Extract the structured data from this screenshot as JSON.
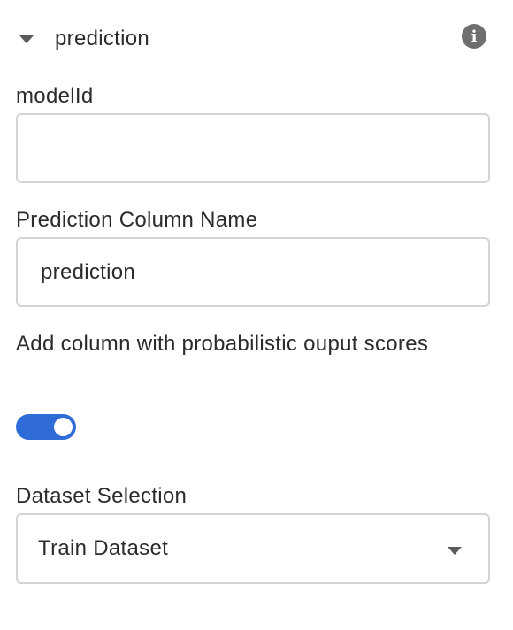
{
  "section": {
    "title": "prediction",
    "expanded": true,
    "collapse_icon": "chevron-down-icon",
    "info_icon": "info-icon",
    "info_glyph": "i"
  },
  "fields": {
    "model_id": {
      "label": "modelId",
      "value": "",
      "placeholder": ""
    },
    "prediction_column": {
      "label": "Prediction Column Name",
      "value": "prediction"
    },
    "probabilistic_scores": {
      "label": "Add column with probabilistic ouput scores",
      "enabled": true
    },
    "dataset_selection": {
      "label": "Dataset Selection",
      "selected": "Train Dataset"
    }
  },
  "colors": {
    "toggle_on": "#2f6cd8",
    "border": "#d4d4d4",
    "text": "#2b2b2b",
    "icon": "#6f6f6f"
  }
}
